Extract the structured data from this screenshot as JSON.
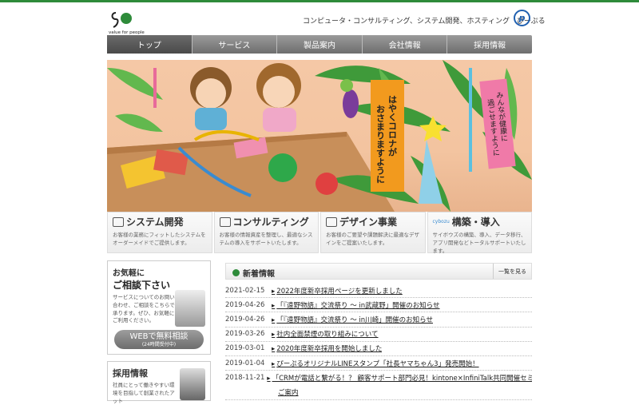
{
  "header": {
    "logo_sub": "value for people",
    "tagline": "コンピュータ・コンサルティング、システム開発、ホスティング　ぴーぷる"
  },
  "nav": [
    "トップ",
    "サービス",
    "製品案内",
    "会社情報",
    "採用情報"
  ],
  "hero": {
    "tanzaku_1": "はやくコロナが おさまりますように",
    "tanzaku_2": "みんなが健康に 過ごせますように"
  },
  "features": [
    {
      "title": "システム開発",
      "desc": "お客様の業務にフィットしたシステムを オーダーメイドでご提供します。"
    },
    {
      "title": "コンサルティング",
      "desc": "お客様の情報資産を整理し、最適なシステムの導入をサポートいたします。"
    },
    {
      "title": "デザイン事業",
      "desc": "お客様のご要望や課題解決に最適なデザインをご提案いたします。"
    },
    {
      "title": "構築・導入",
      "badge": "cybozu",
      "desc": "サイボウズの構築、導入、データ移行、アプリ開発などトータルサポートいたします。"
    }
  ],
  "consult": {
    "h1": "お気軽に",
    "h2": "ご相談下さい",
    "text": "サービスについてのお問い合わせ、ご相談をこちらで承ります。ぜひ、お気軽にご利用ください。",
    "btn": "WEBで無料相談",
    "btn_sub": "(24時間受付中)"
  },
  "recruit": {
    "h": "採用情報",
    "text": "社員にとって働きやすい環境を目指して創業されたアット"
  },
  "news": {
    "title": "新着情報",
    "more": "一覧を見る",
    "items": [
      {
        "date": "2021-02-15",
        "text": "2022年度新卒採用ページを更新しました"
      },
      {
        "date": "2019-04-26",
        "text": "「『遠野物語』交流祭り ～ in武蔵野」開催のお知らせ"
      },
      {
        "date": "2019-04-26",
        "text": "「『遠野物語』交流祭り ～ in川崎」開催のお知らせ"
      },
      {
        "date": "2019-03-26",
        "text": "社内全面禁煙の取り組みについて"
      },
      {
        "date": "2019-03-01",
        "text": "2020年度新卒採用を開始しました"
      },
      {
        "date": "2019-01-04",
        "text": "ぴーぷるオリジナルLINEスタンプ「社長ヤマちゃん3」発売開始！"
      },
      {
        "date": "2018-11-21",
        "text": "「CRMが電話と繋がる！？ 顧客サポート部門必見！kintone×InfiniTalk共同開催セミナー」の"
      },
      {
        "date": "",
        "text": "ご案内"
      }
    ]
  }
}
